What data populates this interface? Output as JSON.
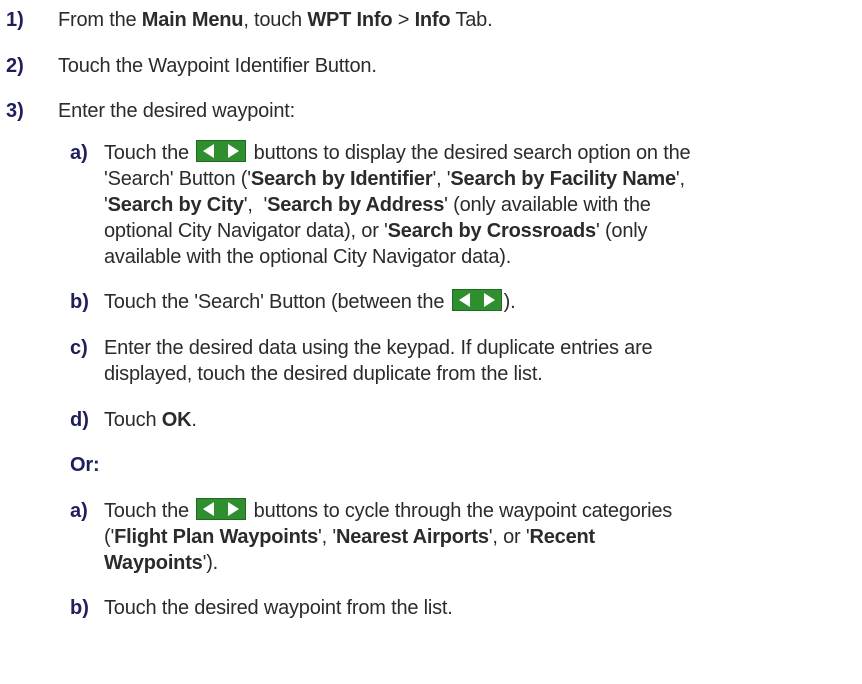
{
  "steps": [
    {
      "num": "1)",
      "parts": {
        "a": "From the ",
        "b": "Main Menu",
        "c": ", touch ",
        "d": "WPT Info",
        "e": " > ",
        "f": "Info",
        "g": " Tab."
      }
    },
    {
      "num": "2)",
      "text": "Touch the Waypoint Identifier Button."
    },
    {
      "num": "3)",
      "text": "Enter the desired waypoint:"
    }
  ],
  "sub1": {
    "a": {
      "label": "a)",
      "l1_pre": "Touch the ",
      "l1_post": " buttons to display the desired search option on the",
      "l2_a": "'Search' Button ('",
      "l2_b": "Search by Identifier",
      "l2_c": "', '",
      "l2_d": "Search by Facility Name",
      "l2_e": "',",
      "l3_a": "'",
      "l3_b": "Search by City",
      "l3_c": "',  '",
      "l3_d": "Search by Address",
      "l3_e": "' (only available with the",
      "l4_a": "optional City Navigator data), or '",
      "l4_b": "Search by Crossroads",
      "l4_c": "' (only",
      "l5": "available with the optional City Navigator data)."
    },
    "b": {
      "label": "b)",
      "pre": "Touch the 'Search' Button (between the ",
      "post": ")."
    },
    "c": {
      "label": "c)",
      "l1": "Enter the desired data using the keypad.  If duplicate entries are",
      "l2": "displayed, touch the desired duplicate from the list."
    },
    "d": {
      "label": "d)",
      "pre": "Touch ",
      "bold": "OK",
      "post": "."
    }
  },
  "or_label": "Or:",
  "sub2": {
    "a": {
      "label": "a)",
      "l1_pre": "Touch the ",
      "l1_post": " buttons to cycle through the waypoint categories",
      "l2_a": "('",
      "l2_b": "Flight Plan Waypoints",
      "l2_c": "', '",
      "l2_d": "Nearest Airports",
      "l2_e": "', or '",
      "l2_f": "Recent",
      "l3_a": "Waypoints",
      "l3_b": "')."
    },
    "b": {
      "label": "b)",
      "text": "Touch the desired waypoint from the list."
    }
  },
  "colors": {
    "number": "#1f1f5c",
    "text": "#2b2b2b",
    "arrow_button": "#2f8f2f"
  },
  "icons": {
    "arrow_buttons": "left-right-arrow-buttons-icon"
  }
}
